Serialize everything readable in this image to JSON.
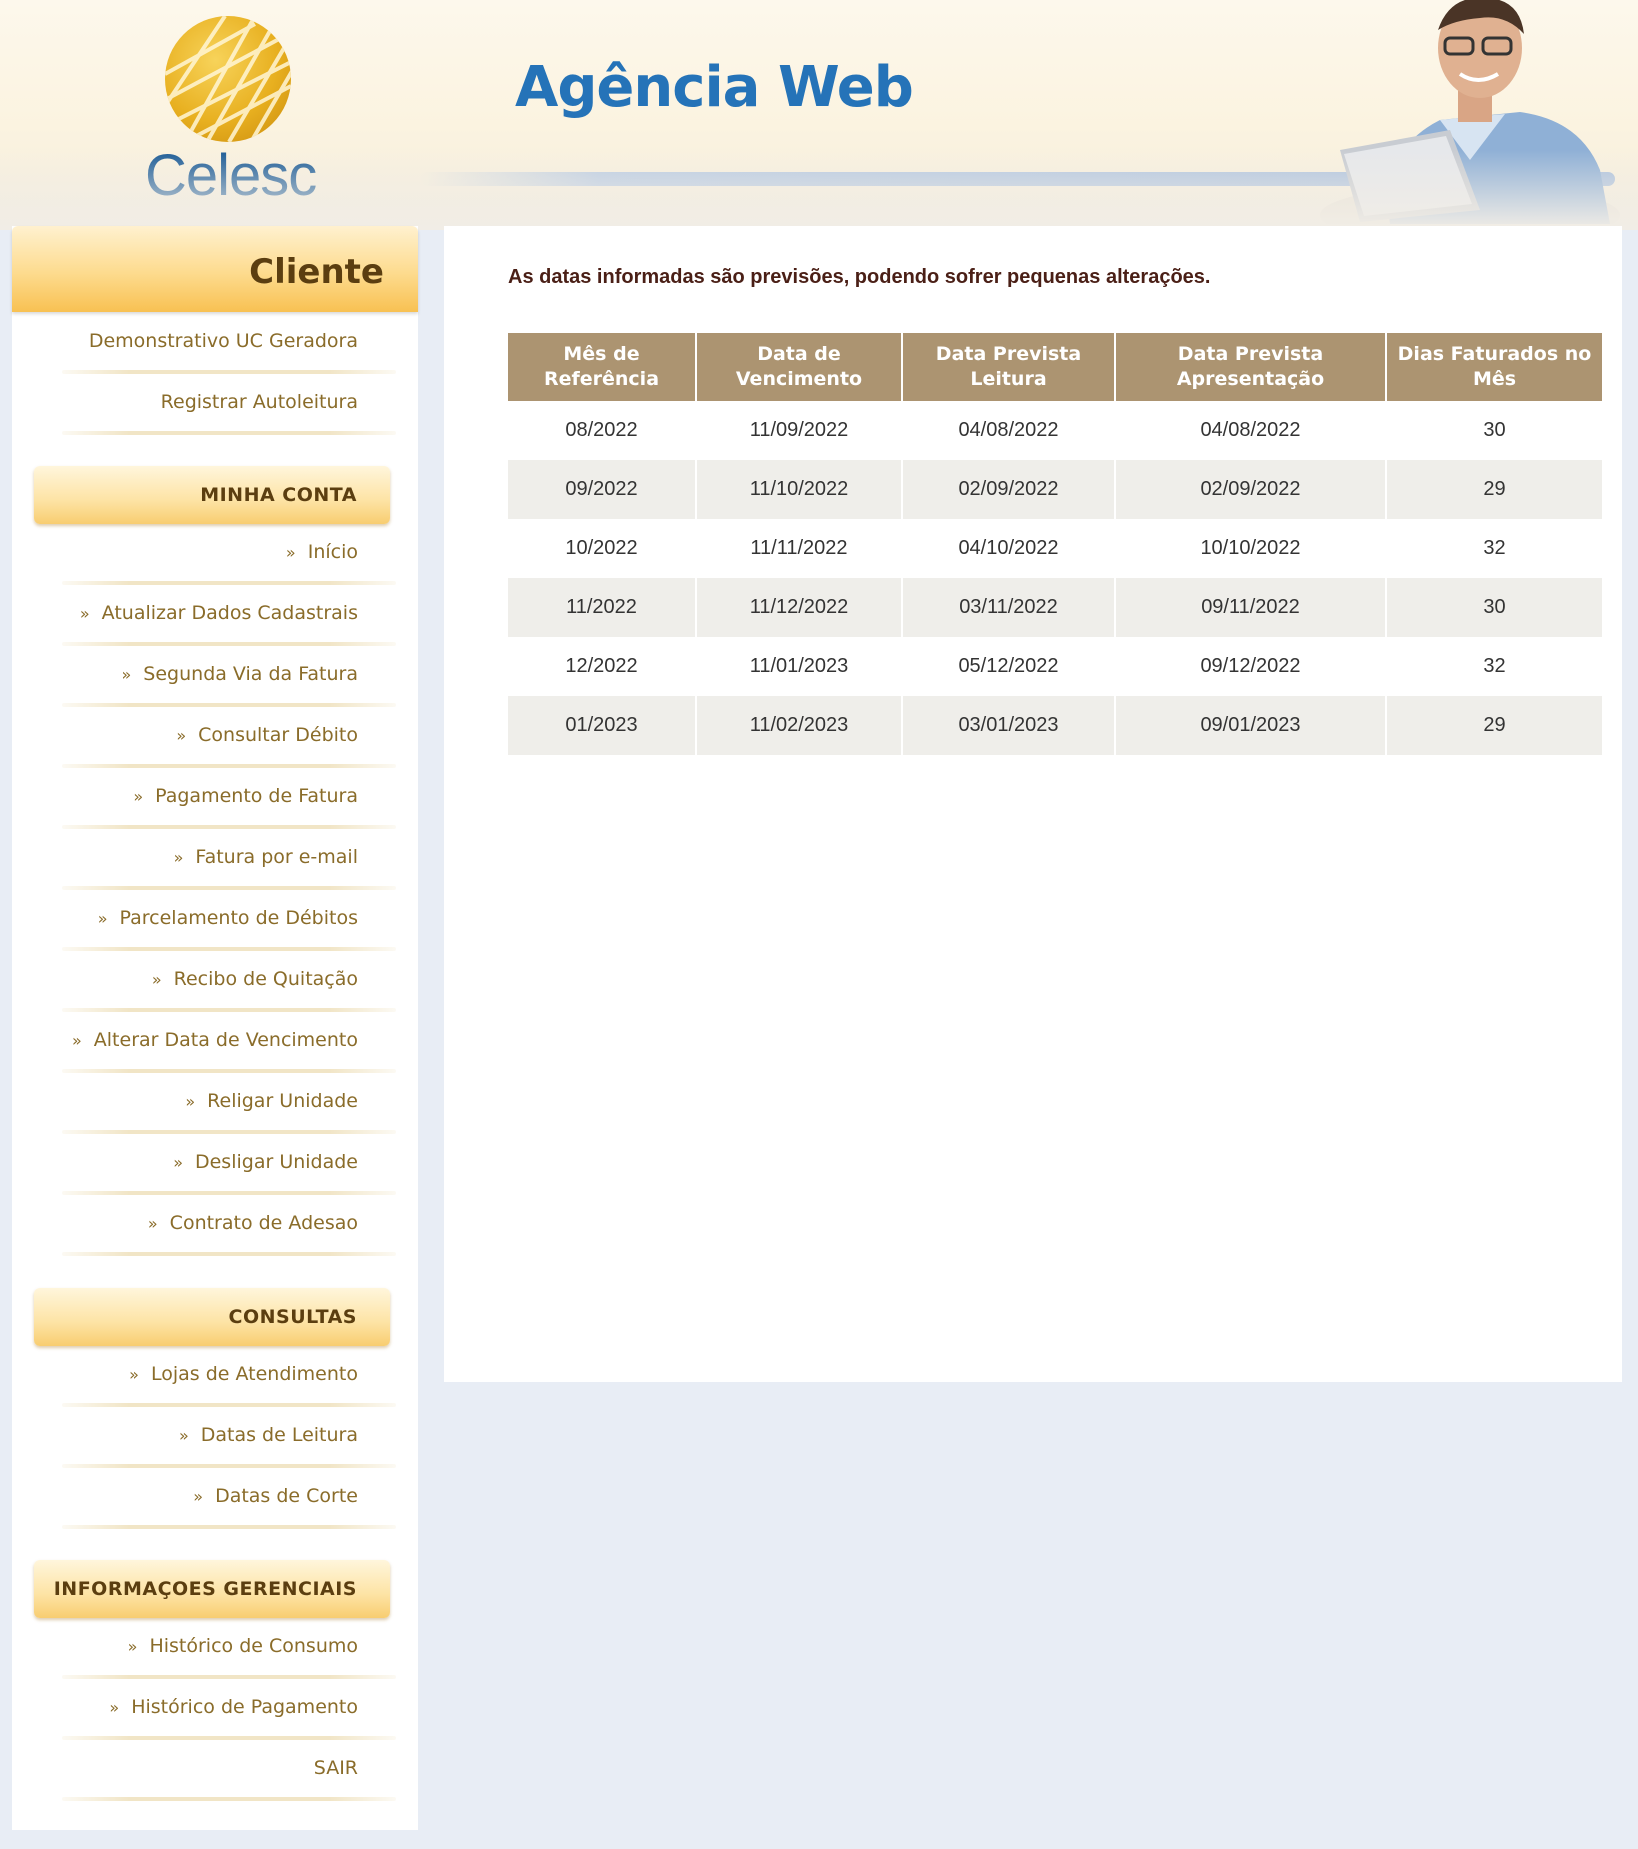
{
  "header": {
    "logo_text": "Celesc",
    "site_title": "Agência Web"
  },
  "sidebar": {
    "title": "Cliente",
    "top_items": [
      {
        "label": "Demonstrativo UC Geradora"
      },
      {
        "label": "Registrar Autoleitura"
      }
    ],
    "sections": [
      {
        "title": "MINHA CONTA",
        "items": [
          {
            "label": "Início"
          },
          {
            "label": "Atualizar Dados Cadastrais"
          },
          {
            "label": "Segunda Via da Fatura"
          },
          {
            "label": "Consultar Débito"
          },
          {
            "label": "Pagamento de Fatura"
          },
          {
            "label": "Fatura por e-mail"
          },
          {
            "label": "Parcelamento de Débitos"
          },
          {
            "label": "Recibo de Quitação"
          },
          {
            "label": "Alterar Data de Vencimento"
          },
          {
            "label": "Religar Unidade"
          },
          {
            "label": "Desligar Unidade"
          },
          {
            "label": "Contrato de Adesao"
          }
        ]
      },
      {
        "title": "CONSULTAS",
        "items": [
          {
            "label": "Lojas de Atendimento"
          },
          {
            "label": "Datas de Leitura"
          },
          {
            "label": "Datas de Corte"
          }
        ]
      },
      {
        "title": "INFORMAÇOES GERENCIAIS",
        "items": [
          {
            "label": "Histórico de Consumo"
          },
          {
            "label": "Histórico de Pagamento"
          }
        ]
      }
    ],
    "logout_label": "SAIR",
    "chevron": "»"
  },
  "main": {
    "notice": "As datas informadas são previsões, podendo sofrer pequenas alterações.",
    "table": {
      "columns": [
        "Mês de Referência",
        "Data de Vencimento",
        "Data Prevista Leitura",
        "Data Prevista Apresentação",
        "Dias Faturados no Mês"
      ],
      "rows": [
        [
          "08/2022",
          "11/09/2022",
          "04/08/2022",
          "04/08/2022",
          "30"
        ],
        [
          "09/2022",
          "11/10/2022",
          "02/09/2022",
          "02/09/2022",
          "29"
        ],
        [
          "10/2022",
          "11/11/2022",
          "04/10/2022",
          "10/10/2022",
          "32"
        ],
        [
          "11/2022",
          "11/12/2022",
          "03/11/2022",
          "09/11/2022",
          "30"
        ],
        [
          "12/2022",
          "11/01/2023",
          "05/12/2022",
          "09/12/2022",
          "32"
        ],
        [
          "01/2023",
          "11/02/2023",
          "03/01/2023",
          "09/01/2023",
          "29"
        ]
      ]
    }
  },
  "colors": {
    "header_accent": "#2573b8",
    "table_header": "#ac9471",
    "menu_text": "#8a6c2a",
    "notice_text": "#4a1f16"
  }
}
